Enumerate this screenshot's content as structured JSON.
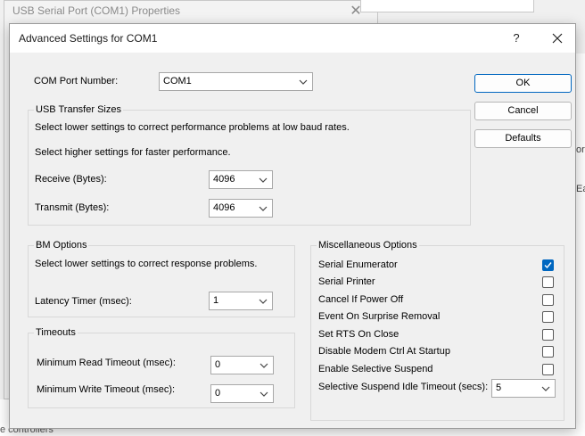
{
  "background": {
    "parent_window_title": "USB Serial Port (COM1) Properties",
    "bottom_fragment": "e controllers",
    "right_fragments": [
      "or",
      "Ea"
    ]
  },
  "dialog": {
    "title": "Advanced Settings for COM1",
    "help_glyph": "?"
  },
  "com_port": {
    "label": "COM Port Number:",
    "value": "COM1"
  },
  "usb_transfer": {
    "title": "USB Transfer Sizes",
    "desc1": "Select lower settings to correct performance problems at low baud rates.",
    "desc2": "Select higher settings for faster performance.",
    "receive_label": "Receive (Bytes):",
    "receive_value": "4096",
    "transmit_label": "Transmit (Bytes):",
    "transmit_value": "4096"
  },
  "bm_options": {
    "title": "BM Options",
    "desc": "Select lower settings to correct response problems.",
    "latency_label": "Latency Timer (msec):",
    "latency_value": "1"
  },
  "timeouts": {
    "title": "Timeouts",
    "read_label": "Minimum Read Timeout (msec):",
    "read_value": "0",
    "write_label": "Minimum Write Timeout (msec):",
    "write_value": "0"
  },
  "misc": {
    "title": "Miscellaneous Options",
    "options": [
      {
        "label": "Serial Enumerator",
        "checked": true
      },
      {
        "label": "Serial Printer",
        "checked": false
      },
      {
        "label": "Cancel If Power Off",
        "checked": false
      },
      {
        "label": "Event On Surprise Removal",
        "checked": false
      },
      {
        "label": "Set RTS On Close",
        "checked": false
      },
      {
        "label": "Disable Modem Ctrl At Startup",
        "checked": false
      },
      {
        "label": "Enable Selective Suspend",
        "checked": false
      }
    ],
    "suspend_label": "Selective Suspend Idle Timeout (secs):",
    "suspend_value": "5"
  },
  "buttons": {
    "ok": "OK",
    "cancel": "Cancel",
    "defaults": "Defaults"
  },
  "colors": {
    "accent": "#0067c0",
    "dialog_bg": "#f0f0f0",
    "titlebar_bg": "#ffffff"
  }
}
